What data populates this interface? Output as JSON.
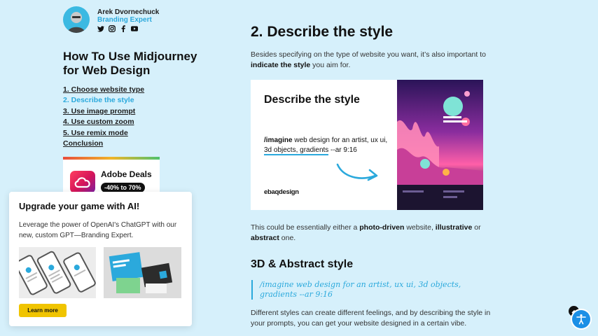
{
  "author": {
    "name": "Arek Dvornechuck",
    "role": "Branding Expert",
    "socials": [
      "twitter-icon",
      "instagram-icon",
      "facebook-icon",
      "youtube-icon"
    ]
  },
  "sidebar": {
    "title": "How To Use Midjourney for Web Design",
    "toc": [
      {
        "label": "1. Choose website type",
        "active": false
      },
      {
        "label": "2. Describe the style",
        "active": true
      },
      {
        "label": "3. Use image prompt",
        "active": false
      },
      {
        "label": "4. Use custom zoom",
        "active": false
      },
      {
        "label": "5. Use remix mode",
        "active": false
      },
      {
        "label": "Conclusion",
        "active": false
      }
    ],
    "ad": {
      "title": "Adobe Deals",
      "badge": "-40% to 70%"
    }
  },
  "promo": {
    "title": "Upgrade your game with AI!",
    "text": "Leverage the power of OpenAI's ChatGPT with our new, custom GPT—Branding Expert.",
    "button": "Learn more"
  },
  "article": {
    "heading": "2. Describe the style",
    "intro_1": "Besides specifying on the type of website you want, it’s also important to ",
    "intro_bold": "indicate the style",
    "intro_2": " you aim for.",
    "image": {
      "title": "Describe the style",
      "prompt_cmd": "/imagine",
      "prompt_1": " web design for an artist, ux ui, ",
      "prompt_highlight": "3d objects, gradients",
      "prompt_2": " --ar 9:16",
      "brand": "ebaqdesign"
    },
    "style_1": "This could be essentially either a ",
    "style_b1": "photo-driven",
    "style_2": " website, ",
    "style_b2": "illustrative",
    "style_3": " or ",
    "style_b3": "abstract",
    "style_4": " one.",
    "subheading": "3D & Abstract style",
    "quote": "/imagine web design for an artist, ux ui, 3d objects, gradients --ar 9:16",
    "outro": "Different styles can create different feelings, and by describing the style in your prompts, you can get your website designed in a certain vibe."
  },
  "colors": {
    "background": "#d6f0fb",
    "accent": "#2ba9dc",
    "button": "#f0c400"
  }
}
